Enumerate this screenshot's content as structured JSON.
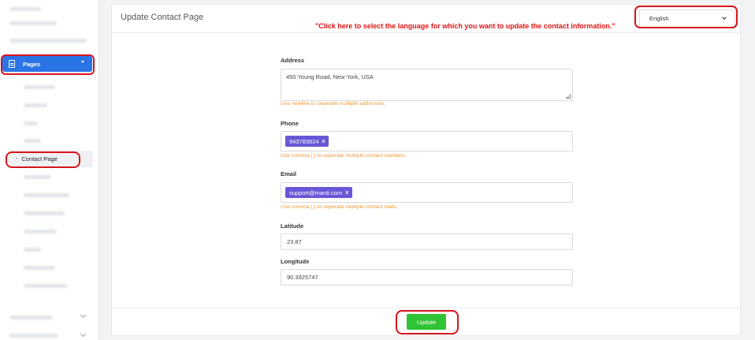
{
  "sidebar": {
    "pages_label": "Pages",
    "contact_label": "Contact Page"
  },
  "header": {
    "title": "Update Contact Page",
    "hint": "\"Click here to select the language for which you want to update the contact information.\"",
    "language_selected": "English"
  },
  "form": {
    "address": {
      "label": "Address",
      "value": "450 Young Road, New York, USA",
      "help": "Use newline to seperate multiple addresses."
    },
    "phone": {
      "label": "Phone",
      "tag": "943783924",
      "help": "Use comma (,) to seperate multiple contact numbers."
    },
    "email": {
      "label": "Email",
      "tag": "support@manti.com",
      "help": "Use comma (,) to seperate multiple contact mails."
    },
    "latitude": {
      "label": "Latitude",
      "value": "23.87"
    },
    "longitude": {
      "label": "Longitude",
      "value": "90.3925747"
    },
    "tag_remove_symbol": "x"
  },
  "footer": {
    "update_label": "Update"
  },
  "colors": {
    "accent_blue": "#2a74e6",
    "update_green": "#2fc335",
    "tag_purple": "#6857d6",
    "help_orange": "#f0962e",
    "annotation_red": "#d9141b"
  },
  "icons": {
    "pages": "page-icon",
    "pages_expand": "chevron-down-icon",
    "language_dropdown": "chevron-down-icon",
    "textarea_resize": "resize-handle-icon"
  }
}
